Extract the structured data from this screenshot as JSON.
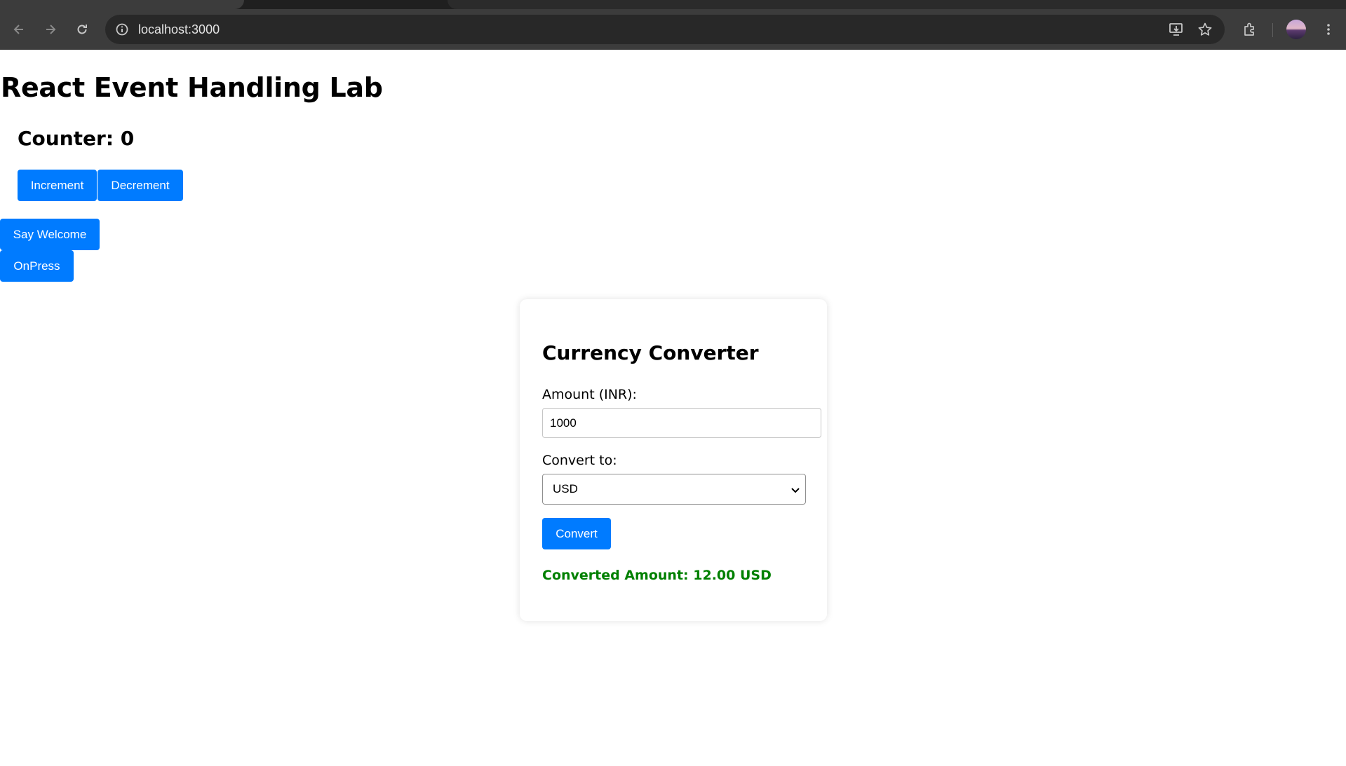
{
  "browser": {
    "url": "localhost:3000"
  },
  "page": {
    "title": "React Event Handling Lab",
    "counter_label": "Counter: 0",
    "buttons": {
      "increment": "Increment",
      "decrement": "Decrement",
      "say_welcome": "Say Welcome",
      "onpress": "OnPress"
    }
  },
  "converter": {
    "heading": "Currency Converter",
    "amount_label": "Amount (INR):",
    "amount_value": "1000",
    "convert_to_label": "Convert to:",
    "selected_currency": "USD",
    "convert_button": "Convert",
    "result": "Converted Amount: 12.00 USD"
  },
  "colors": {
    "primary_button": "#007bff",
    "result_text": "#008000",
    "chrome_toolbar": "#3c3c3c"
  },
  "icons": [
    "back-arrow-icon",
    "forward-arrow-icon",
    "reload-icon",
    "site-info-icon",
    "install-app-icon",
    "bookmark-star-icon",
    "extensions-icon",
    "profile-avatar",
    "menu-dots-icon",
    "chevron-down-icon"
  ]
}
